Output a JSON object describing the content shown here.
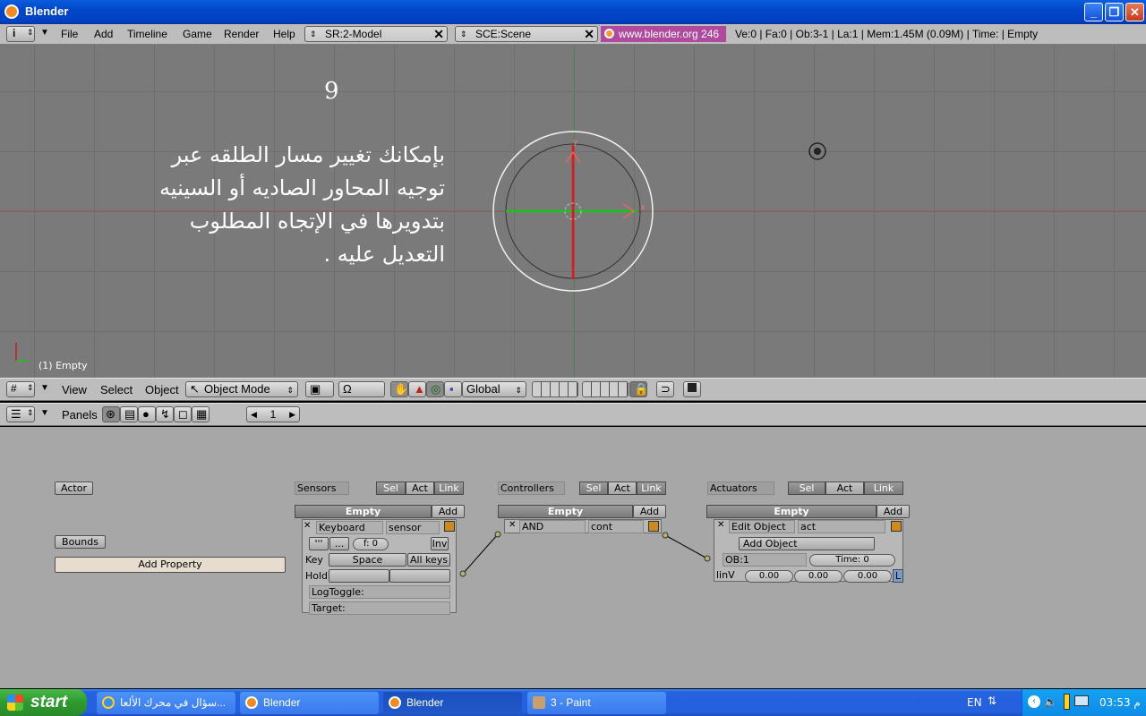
{
  "window": {
    "title": "Blender"
  },
  "menubar": {
    "items": [
      "File",
      "Add",
      "Timeline",
      "Game",
      "Render",
      "Help"
    ],
    "screen_field": "SR:2-Model",
    "scene_field": "SCE:Scene",
    "site": "www.blender.org 246",
    "stats": "Ve:0 | Fa:0 | Ob:3-1 | La:1  | Mem:1.45M (0.09M)  | Time: | Empty"
  },
  "viewport": {
    "slide_number": "9",
    "arabic_text": "بإمكانك تغيير مسار الطلقه عبر توجيه المحاور الصاديه أو السينيه بتدويرها في الإتجاه المطلوب التعديل عليه .",
    "object_label": "(1) Empty",
    "axis_y_label": "y",
    "axis_x_label": "x"
  },
  "view3d_header": {
    "items": [
      "View",
      "Select",
      "Object"
    ],
    "mode": "Object Mode",
    "orientation": "Global"
  },
  "buttons_header": {
    "panels_label": "Panels",
    "frame": "1"
  },
  "logic": {
    "actor_btn": "Actor",
    "bounds_btn": "Bounds",
    "add_property_btn": "Add Property",
    "sensors": {
      "title": "Sensors",
      "sel": "Sel",
      "act": "Act",
      "link": "Link",
      "object": "Empty",
      "add": "Add",
      "type": "Keyboard",
      "name": "sensor",
      "pulse1": "'''",
      "pulse2": "...",
      "freq": "f: 0",
      "inv": "Inv",
      "key_label": "Key",
      "key_value": "Space",
      "all_keys": "All keys",
      "hold_label": "Hold",
      "logtoggle": "LogToggle:",
      "target": "Target:"
    },
    "controllers": {
      "title": "Controllers",
      "sel": "Sel",
      "act": "Act",
      "link": "Link",
      "object": "Empty",
      "add": "Add",
      "type": "AND",
      "name": "cont"
    },
    "actuators": {
      "title": "Actuators",
      "sel": "Sel",
      "act": "Act",
      "link": "Link",
      "object": "Empty",
      "add": "Add",
      "type": "Edit Object",
      "name": "act",
      "mode": "Add Object",
      "ob": "OB:1",
      "time": "Time: 0",
      "linv_label": "linV",
      "linv": [
        "0.00",
        "0.00",
        "0.00"
      ],
      "local": "L"
    }
  },
  "taskbar": {
    "start": "start",
    "tasks": [
      {
        "label": "سؤال في محرك الألعا...",
        "active": false,
        "icon": "ie-icon"
      },
      {
        "label": "Blender",
        "active": false,
        "icon": "blender-icon"
      },
      {
        "label": "Blender",
        "active": true,
        "icon": "blender-icon"
      },
      {
        "label": "3 - Paint",
        "active": false,
        "icon": "paint-icon"
      }
    ],
    "lang": "EN",
    "clock": "03:53 م"
  },
  "colors": {
    "xp_blue": "#2562e0",
    "blender_gray": "#bdbdbd",
    "viewport_gray": "#7a7a7a",
    "site_purple": "#b04a9f"
  }
}
